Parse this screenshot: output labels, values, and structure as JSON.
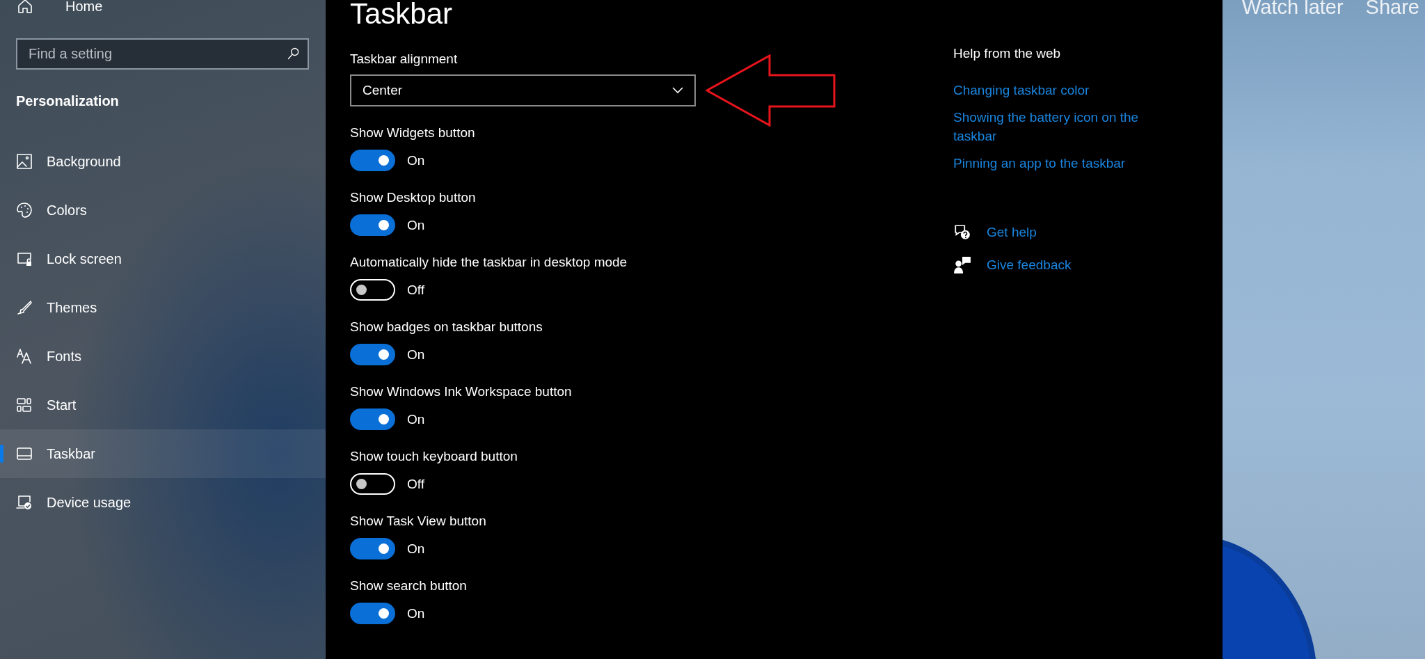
{
  "sidebar": {
    "home": "Home",
    "search": {
      "placeholder": "Find a setting"
    },
    "section": "Personalization",
    "items": [
      {
        "label": "Background",
        "selected": false
      },
      {
        "label": "Colors",
        "selected": false
      },
      {
        "label": "Lock screen",
        "selected": false
      },
      {
        "label": "Themes",
        "selected": false
      },
      {
        "label": "Fonts",
        "selected": false
      },
      {
        "label": "Start",
        "selected": false
      },
      {
        "label": "Taskbar",
        "selected": true
      },
      {
        "label": "Device usage",
        "selected": false
      }
    ]
  },
  "main": {
    "title": "Taskbar",
    "alignment": {
      "label": "Taskbar alignment",
      "value": "Center"
    },
    "toggles": [
      {
        "label": "Show Widgets button",
        "on": true,
        "state": "On"
      },
      {
        "label": "Show Desktop button",
        "on": true,
        "state": "On"
      },
      {
        "label": "Automatically hide the taskbar in desktop mode",
        "on": false,
        "state": "Off"
      },
      {
        "label": "Show badges on taskbar buttons",
        "on": true,
        "state": "On"
      },
      {
        "label": "Show Windows Ink Workspace button",
        "on": true,
        "state": "On"
      },
      {
        "label": "Show touch keyboard button",
        "on": false,
        "state": "Off"
      },
      {
        "label": "Show Task View button",
        "on": true,
        "state": "On"
      },
      {
        "label": "Show search button",
        "on": true,
        "state": "On"
      }
    ]
  },
  "help": {
    "title": "Help from the web",
    "links": [
      "Changing taskbar color",
      "Showing the battery icon on the taskbar",
      "Pinning an app to the taskbar"
    ],
    "actions": [
      "Get help",
      "Give feedback"
    ]
  },
  "video_overlay": {
    "buttons": [
      "Watch later",
      "Share"
    ]
  }
}
